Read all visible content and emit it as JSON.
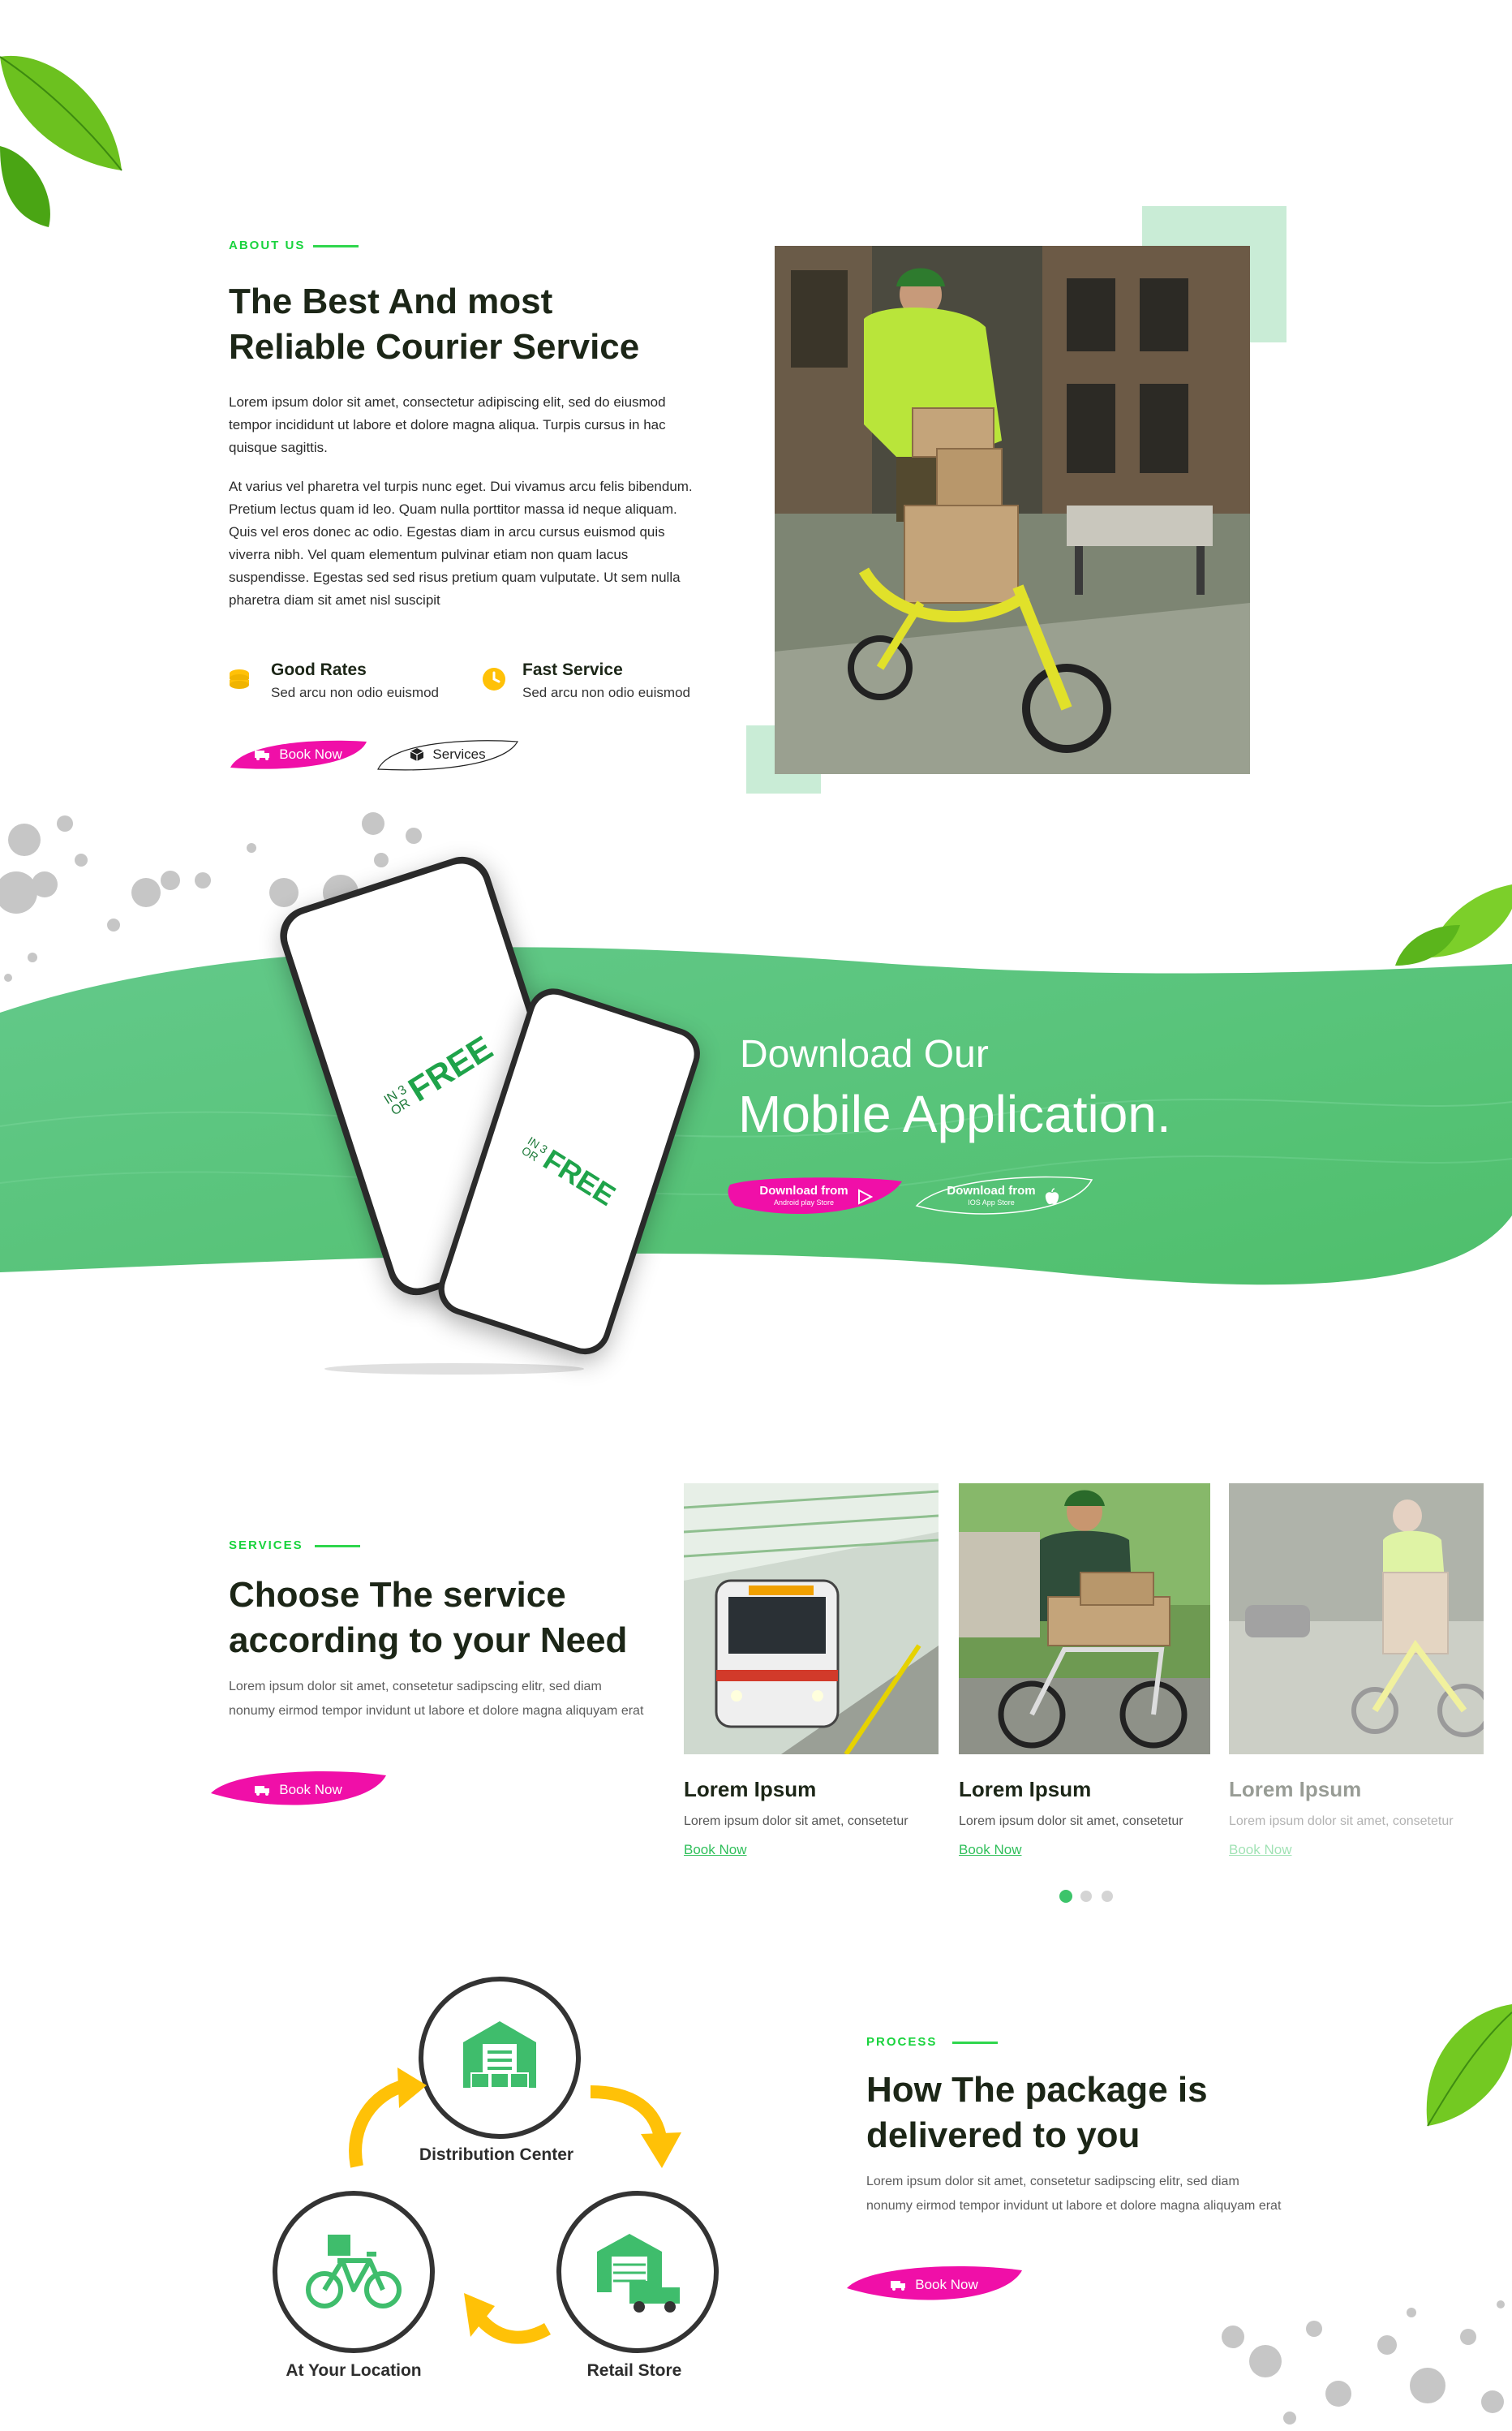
{
  "about": {
    "eyebrow": "ABOUT US",
    "title_line1": "The Best And most",
    "title_line2": "Reliable Courier Service",
    "para1": "Lorem ipsum dolor sit amet, consectetur adipiscing elit, sed do eiusmod tempor incididunt ut labore et dolore magna aliqua. Turpis cursus in hac quisque sagittis.",
    "para2": "At varius vel pharetra vel turpis nunc eget. Dui vivamus arcu felis bibendum. Pretium lectus quam id leo. Quam nulla porttitor massa id neque aliquam. Quis vel eros donec ac odio. Egestas diam in arcu cursus euismod quis viverra nibh. Vel quam elementum pulvinar etiam non quam lacus suspendisse. Egestas sed sed risus pretium quam vulputate. Ut sem nulla pharetra diam sit amet nisl suscipit",
    "features": [
      {
        "title": "Good Rates",
        "sub": "Sed arcu non odio euismod",
        "icon": "coins-icon"
      },
      {
        "title": "Fast Service",
        "sub": "Sed arcu non odio euismod",
        "icon": "clock-icon"
      }
    ],
    "book_label": "Book Now",
    "services_label": "Services"
  },
  "app": {
    "line1": "Download Our",
    "line2": "Mobile Application.",
    "android_label": "Download from",
    "android_sub": "Android play Store",
    "ios_label": "Download from",
    "ios_sub": "IOS App Store",
    "phone_logo_small": "IN 3",
    "phone_logo_or": "OR",
    "phone_logo_big": "FREE"
  },
  "services": {
    "eyebrow": "SERVICES",
    "title_line1": "Choose The service",
    "title_line2": "according to your Need",
    "para": "Lorem ipsum dolor sit amet, consetetur sadipscing elitr, sed diam nonumy eirmod tempor invidunt ut labore et dolore magna aliquyam erat",
    "book_label": "Book Now",
    "cards": [
      {
        "title": "Lorem Ipsum",
        "text": "Lorem ipsum dolor sit amet, consetetur",
        "link": "Book Now"
      },
      {
        "title": "Lorem Ipsum",
        "text": "Lorem ipsum dolor sit amet, consetetur",
        "link": "Book Now"
      },
      {
        "title": "Lorem Ipsum",
        "text": "Lorem ipsum dolor sit amet, consetetur",
        "link": "Book Now"
      }
    ],
    "active_dot": 0
  },
  "process": {
    "eyebrow": "PROCESS",
    "title_line1": "How The package is",
    "title_line2": "delivered to you",
    "para": "Lorem ipsum dolor sit amet, consetetur sadipscing elitr, sed diam nonumy eirmod tempor invidunt ut labore et dolore magna aliquyam erat",
    "book_label": "Book Now",
    "steps": [
      "Distribution Center",
      "Retail Store",
      "At Your Location"
    ]
  },
  "colors": {
    "green": "#5cc77b",
    "accent_green": "#19d33d",
    "pink": "#f00fa8",
    "yellow": "#ffc107",
    "dark": "#1c2617"
  }
}
